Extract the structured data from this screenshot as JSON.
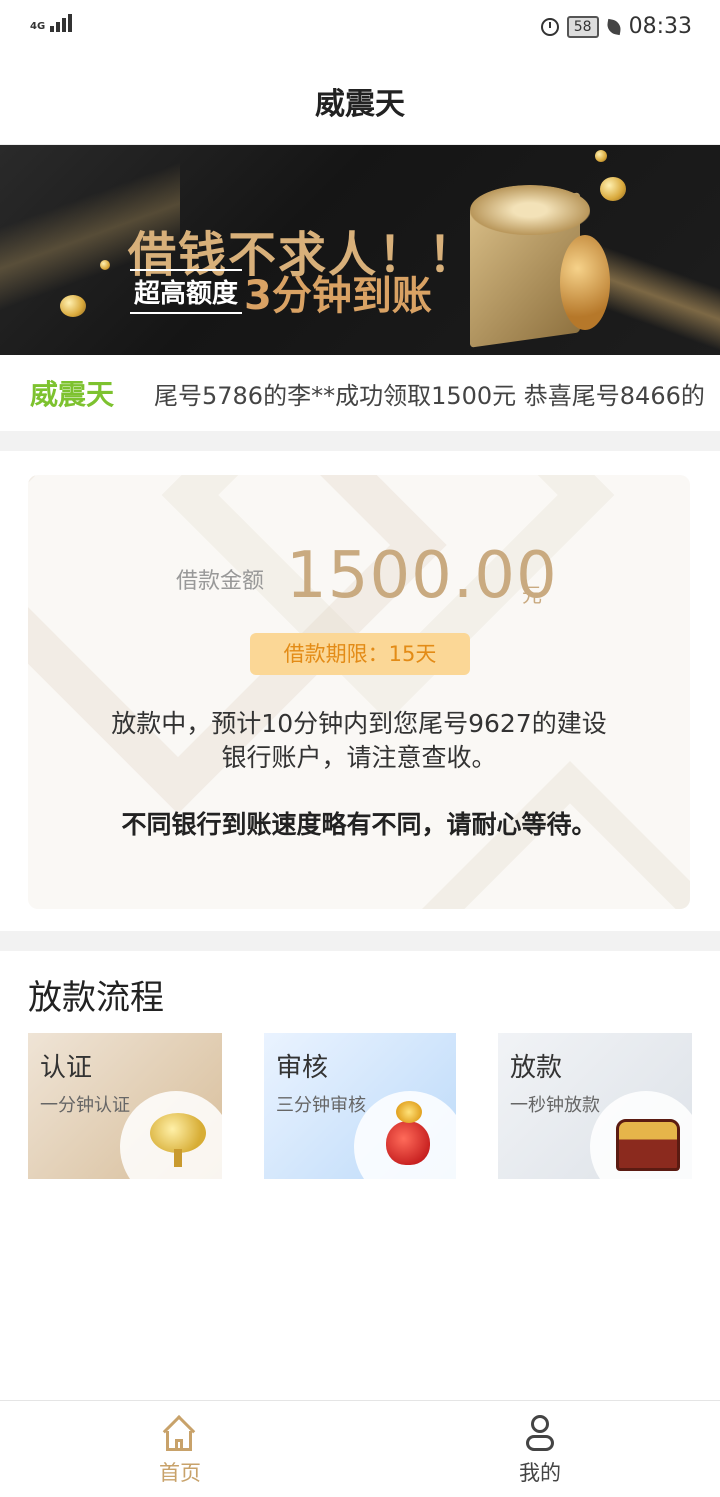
{
  "status_bar": {
    "network": "4G",
    "battery": "58",
    "time": "08:33"
  },
  "header": {
    "title": "威震天"
  },
  "banner": {
    "headline": "借钱不求人！！",
    "tag": "超高额度",
    "slogan": "3分钟到账"
  },
  "marquee": {
    "title": "威震天",
    "text": "尾号5786的李**成功领取1500元 恭喜尾号8466的"
  },
  "loan_card": {
    "amount_label": "借款金额",
    "amount": "1500.00",
    "unit": "元",
    "term": "借款期限：15天",
    "message_line1": "放款中，预计10分钟内到您尾号9627的建设",
    "message_line2": "银行账户，请注意查收。",
    "note": "不同银行到账速度略有不同，请耐心等待。"
  },
  "flow": {
    "title": "放款流程",
    "steps": [
      {
        "title": "认证",
        "subtitle": "一分钟认证",
        "icon": "money-tree-icon"
      },
      {
        "title": "审核",
        "subtitle": "三分钟审核",
        "icon": "lucky-bag-icon"
      },
      {
        "title": "放款",
        "subtitle": "一秒钟放款",
        "icon": "treasure-chest-icon"
      }
    ]
  },
  "tabbar": {
    "home": "首页",
    "me": "我的",
    "active_color": "#c8a26a",
    "inactive_color": "#444444"
  }
}
